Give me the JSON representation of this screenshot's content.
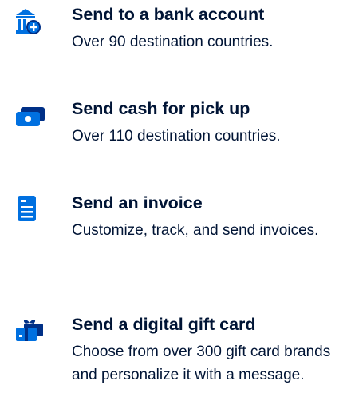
{
  "options": [
    {
      "title": "Send to a bank account",
      "description": "Over 90 destination countries.",
      "icon": "bank-plus-icon"
    },
    {
      "title": "Send cash for pick up",
      "description": "Over 110 destination countries.",
      "icon": "cash-icon"
    },
    {
      "title": "Send an invoice",
      "description": "Customize, track, and send invoices.",
      "icon": "invoice-icon"
    },
    {
      "title": "Send a digital gift card",
      "description": "Choose from over 300 gift card brands and personalize it with a message.",
      "icon": "gift-card-icon"
    }
  ],
  "colors": {
    "text": "#001435",
    "icon_primary": "#0070e0",
    "icon_dark": "#003087"
  }
}
